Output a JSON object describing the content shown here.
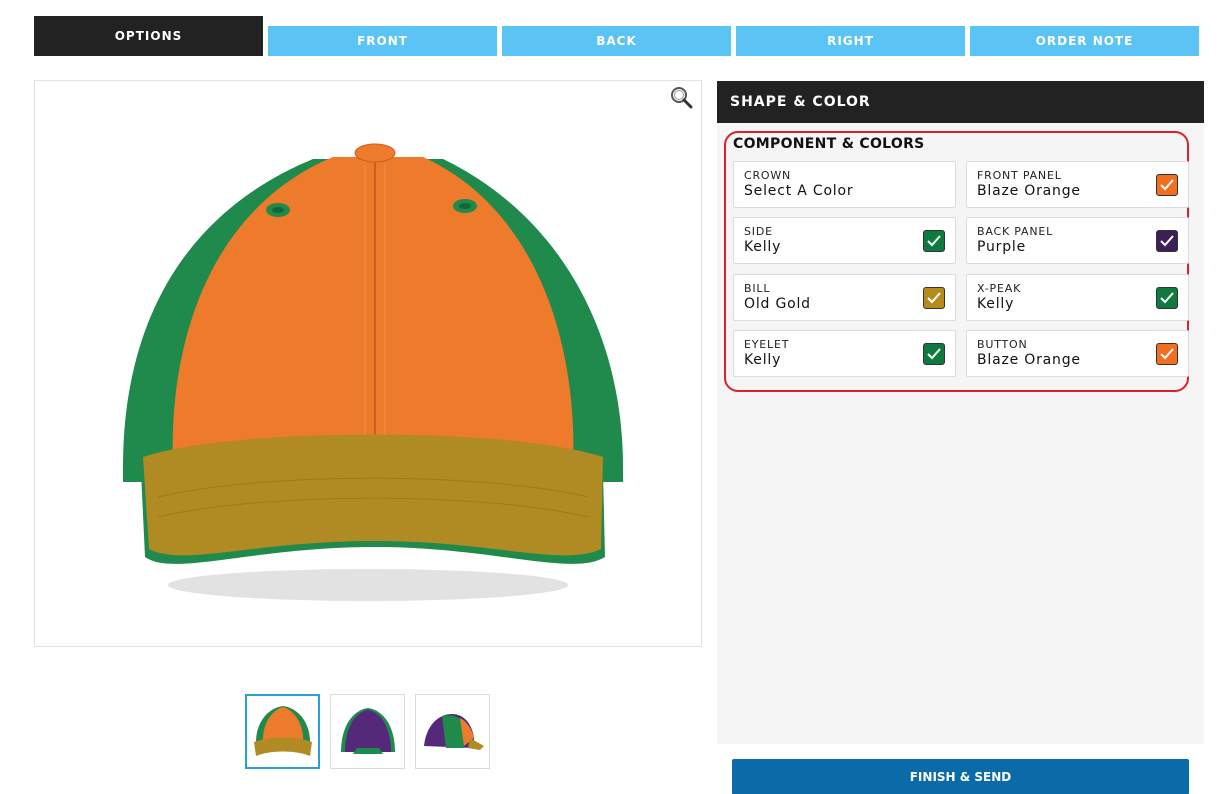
{
  "tabs": [
    {
      "label": "OPTIONS",
      "active": true
    },
    {
      "label": "FRONT"
    },
    {
      "label": "BACK"
    },
    {
      "label": "RIGHT"
    },
    {
      "label": "ORDER NOTE"
    }
  ],
  "panel": {
    "title": "SHAPE & COLOR",
    "section_title": "COMPONENT & COLORS",
    "components": [
      {
        "label": "CROWN",
        "value": "Select A Color",
        "swatch": null
      },
      {
        "label": "FRONT PANEL",
        "value": "Blaze Orange",
        "swatch": "#f26f21"
      },
      {
        "label": "SIDE",
        "value": "Kelly",
        "swatch": "#0f7a3f"
      },
      {
        "label": "BACK PANEL",
        "value": "Purple",
        "swatch": "#3c1f59"
      },
      {
        "label": "BILL",
        "value": "Old Gold",
        "swatch": "#b58b1c"
      },
      {
        "label": "X-PEAK",
        "value": "Kelly",
        "swatch": "#0f7a3f"
      },
      {
        "label": "EYELET",
        "value": "Kelly",
        "swatch": "#0f7a3f"
      },
      {
        "label": "BUTTON",
        "value": "Blaze Orange",
        "swatch": "#f26f21"
      }
    ]
  },
  "finish_label": "FINISH & SEND",
  "colors": {
    "tab_inactive": "#5bc4f5",
    "tab_active": "#222222",
    "highlight_border": "#d8232a",
    "finish_button": "#0b6aa8",
    "orange": "#ee7a2c",
    "kelly": "#1f8a4c",
    "old_gold": "#b08a22",
    "purple": "#55287a"
  },
  "icons": {
    "zoom": "magnifier-icon",
    "check": "checkmark-icon"
  }
}
